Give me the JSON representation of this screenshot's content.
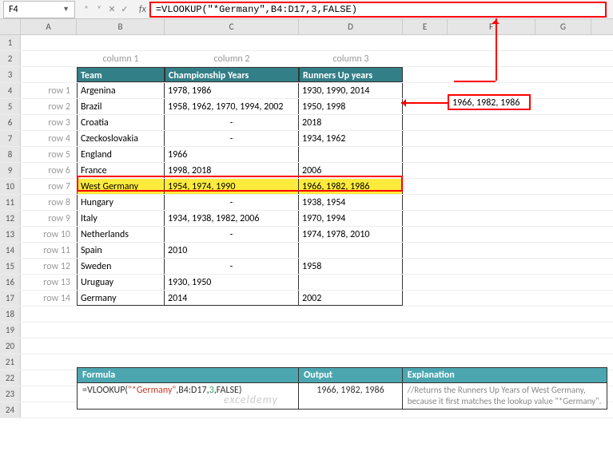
{
  "selected_cell": "F4",
  "formula": "=VLOOKUP(\"*Germany\",B4:D17,3,FALSE)",
  "result_value": "1966, 1982, 1986",
  "columns": [
    "A",
    "B",
    "C",
    "D",
    "E",
    "F",
    "G"
  ],
  "col_labels": [
    "column 1",
    "column 2",
    "column 3"
  ],
  "row_labels": [
    "row 1",
    "row 2",
    "row 3",
    "row 4",
    "row 5",
    "row 6",
    "row 7",
    "row 8",
    "row 9",
    "row 10",
    "row 11",
    "row 12",
    "row 13",
    "row 14"
  ],
  "headers": [
    "Team",
    "Championship Years",
    "Runners Up years"
  ],
  "table": [
    {
      "team": "Argenina",
      "champ": "1978, 1986",
      "runner": "1930, 1990, 2014"
    },
    {
      "team": "Brazil",
      "champ": "1958, 1962, 1970, 1994, 2002",
      "runner": "1950, 1998"
    },
    {
      "team": "Croatia",
      "champ": "-",
      "runner": "2018"
    },
    {
      "team": "Czeckoslovakia",
      "champ": "-",
      "runner": "1934, 1962"
    },
    {
      "team": "England",
      "champ": "1966",
      "runner": ""
    },
    {
      "team": "France",
      "champ": "1998, 2018",
      "runner": "2006"
    },
    {
      "team": "West Germany",
      "champ": "1954, 1974, 1990",
      "runner": "1966, 1982, 1986",
      "hl": true
    },
    {
      "team": "Hungary",
      "champ": "-",
      "runner": "1938, 1954"
    },
    {
      "team": "Italy",
      "champ": "1934, 1938, 1982, 2006",
      "runner": "1970, 1994"
    },
    {
      "team": "Netherlands",
      "champ": "-",
      "runner": "1974, 1978, 2010"
    },
    {
      "team": "Spain",
      "champ": "2010",
      "runner": ""
    },
    {
      "team": "Sweden",
      "champ": "-",
      "runner": "1958"
    },
    {
      "team": "Uruguay",
      "champ": "1930, 1950",
      "runner": ""
    },
    {
      "team": "Germany",
      "champ": "2014",
      "runner": "2002"
    }
  ],
  "formula_box": {
    "headers": [
      "Formula",
      "Output",
      "Explanation"
    ],
    "formula_parts": {
      "pre": "=VLOOKUP(",
      "q": "\"*Germany\"",
      "mid": ",B4:D17,",
      "n": "3",
      "post": ",FALSE)"
    },
    "output": "1966, 1982, 1986",
    "explanation": "//Returns the Runners Up Years of West Germany, because it first matches the lookup value \"*Germany\"."
  },
  "watermark": "exceldemy"
}
